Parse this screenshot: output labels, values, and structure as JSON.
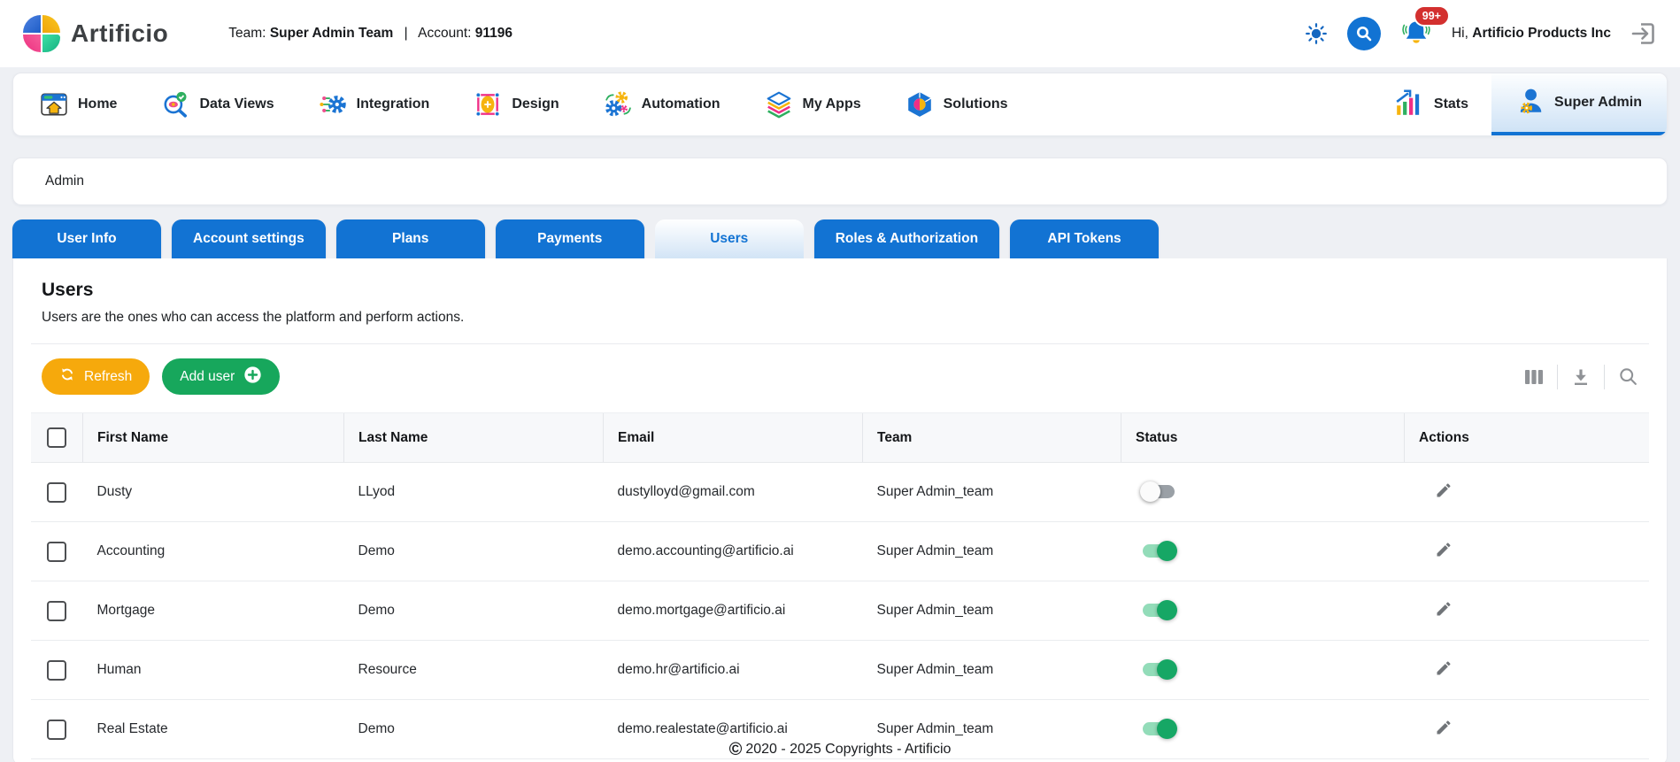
{
  "header": {
    "logo_text": "Artificio",
    "team_label": "Team:",
    "team_value": "Super Admin Team",
    "separator": "|",
    "account_label": "Account:",
    "account_value": "91196",
    "notification_badge": "99+",
    "greeting_prefix": "Hi,",
    "greeting_name": "Artificio Products Inc",
    "icons": [
      "theme-sun-icon",
      "search-icon",
      "notifications-bell-icon",
      "logout-icon"
    ]
  },
  "nav": {
    "items": [
      {
        "label": "Home",
        "icon": "home-icon"
      },
      {
        "label": "Data Views",
        "icon": "data-views-icon"
      },
      {
        "label": "Integration",
        "icon": "integration-icon"
      },
      {
        "label": "Design",
        "icon": "design-icon"
      },
      {
        "label": "Automation",
        "icon": "automation-icon"
      },
      {
        "label": "My Apps",
        "icon": "my-apps-icon"
      },
      {
        "label": "Solutions",
        "icon": "solutions-icon"
      }
    ],
    "stats": {
      "label": "Stats",
      "icon": "stats-icon"
    },
    "super_admin": {
      "label": "Super Admin",
      "icon": "super-admin-icon",
      "active": true
    }
  },
  "breadcrumb": "Admin",
  "tabs": [
    {
      "label": "User Info",
      "active": false
    },
    {
      "label": "Account settings",
      "active": false
    },
    {
      "label": "Plans",
      "active": false
    },
    {
      "label": "Payments",
      "active": false
    },
    {
      "label": "Users",
      "active": true
    },
    {
      "label": "Roles & Authorization",
      "active": false
    },
    {
      "label": "API Tokens",
      "active": false
    }
  ],
  "section": {
    "title": "Users",
    "subtitle": "Users are the ones who can access the platform and perform actions."
  },
  "toolbar": {
    "refresh_label": "Refresh",
    "add_user_label": "Add user",
    "icons": [
      "columns-icon",
      "download-icon",
      "table-search-icon"
    ]
  },
  "table": {
    "headers": [
      "First Name",
      "Last Name",
      "Email",
      "Team",
      "Status",
      "Actions"
    ],
    "rows": [
      {
        "first_name": "Dusty",
        "last_name": "LLyod",
        "email": "dustylloyd@gmail.com",
        "team": "Super Admin_team",
        "status_on": false
      },
      {
        "first_name": "Accounting",
        "last_name": "Demo",
        "email": "demo.accounting@artificio.ai",
        "team": "Super Admin_team",
        "status_on": true
      },
      {
        "first_name": "Mortgage",
        "last_name": "Demo",
        "email": "demo.mortgage@artificio.ai",
        "team": "Super Admin_team",
        "status_on": true
      },
      {
        "first_name": "Human",
        "last_name": "Resource",
        "email": "demo.hr@artificio.ai",
        "team": "Super Admin_team",
        "status_on": true
      },
      {
        "first_name": "Real Estate",
        "last_name": "Demo",
        "email": "demo.realestate@artificio.ai",
        "team": "Super Admin_team",
        "status_on": true
      }
    ]
  },
  "footer": {
    "symbol": "©",
    "text": "2020 - 2025 Copyrights - Artificio"
  },
  "colors": {
    "primary_blue": "#1273d3",
    "refresh_orange": "#f6a90c",
    "add_user_green": "#17a75c",
    "toggle_on_green": "#16a765",
    "toggle_track_green": "#93dcb9",
    "badge_red": "#d3302f",
    "logo_blue": "#2e6fd6",
    "logo_yellow": "#f6b40e",
    "logo_pink": "#f0408c",
    "logo_teal": "#25cf96"
  }
}
